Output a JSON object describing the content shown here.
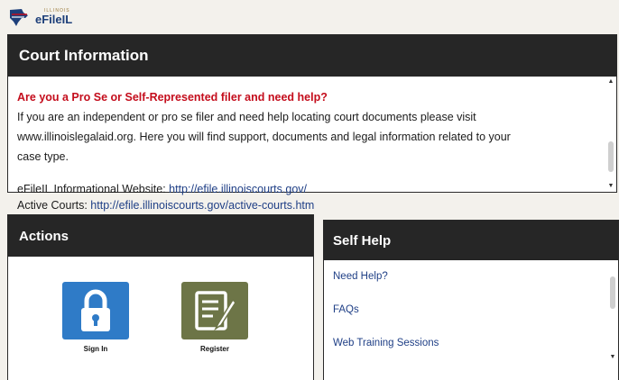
{
  "logo": {
    "subtext": "ILLINOIS",
    "name": "eFileIL"
  },
  "court": {
    "header": "Court Information",
    "heading": "Are you a Pro Se or Self-Represented filer and need help?",
    "line1": "If you are an independent or pro se filer and need help locating court documents please visit",
    "line2": "www.illinoislegalaid.org.  Here you will find support, documents and legal information related to your",
    "line3": "case type.",
    "website_label": "eFileIL Informational Website:",
    "website_url": "http://efile.illinoiscourts.gov/",
    "active_label": "Active Courts:",
    "active_url": "http://efile.illinoiscourts.gov/active-courts.htm"
  },
  "actions": {
    "header": "Actions",
    "sign_in": "Sign In",
    "register": "Register"
  },
  "self_help": {
    "header": "Self Help",
    "items": [
      "Need Help?",
      "FAQs",
      "Web Training Sessions"
    ]
  },
  "colors": {
    "header_bg": "#262626",
    "link": "#1f3f86",
    "alert": "#c40d1c",
    "sign_in_tile": "#2f7bc7",
    "register_tile": "#6d7547"
  },
  "icons": {
    "sign_in": "lock-icon",
    "register": "notepad-pencil-icon",
    "logo": "illinois-state-icon"
  }
}
